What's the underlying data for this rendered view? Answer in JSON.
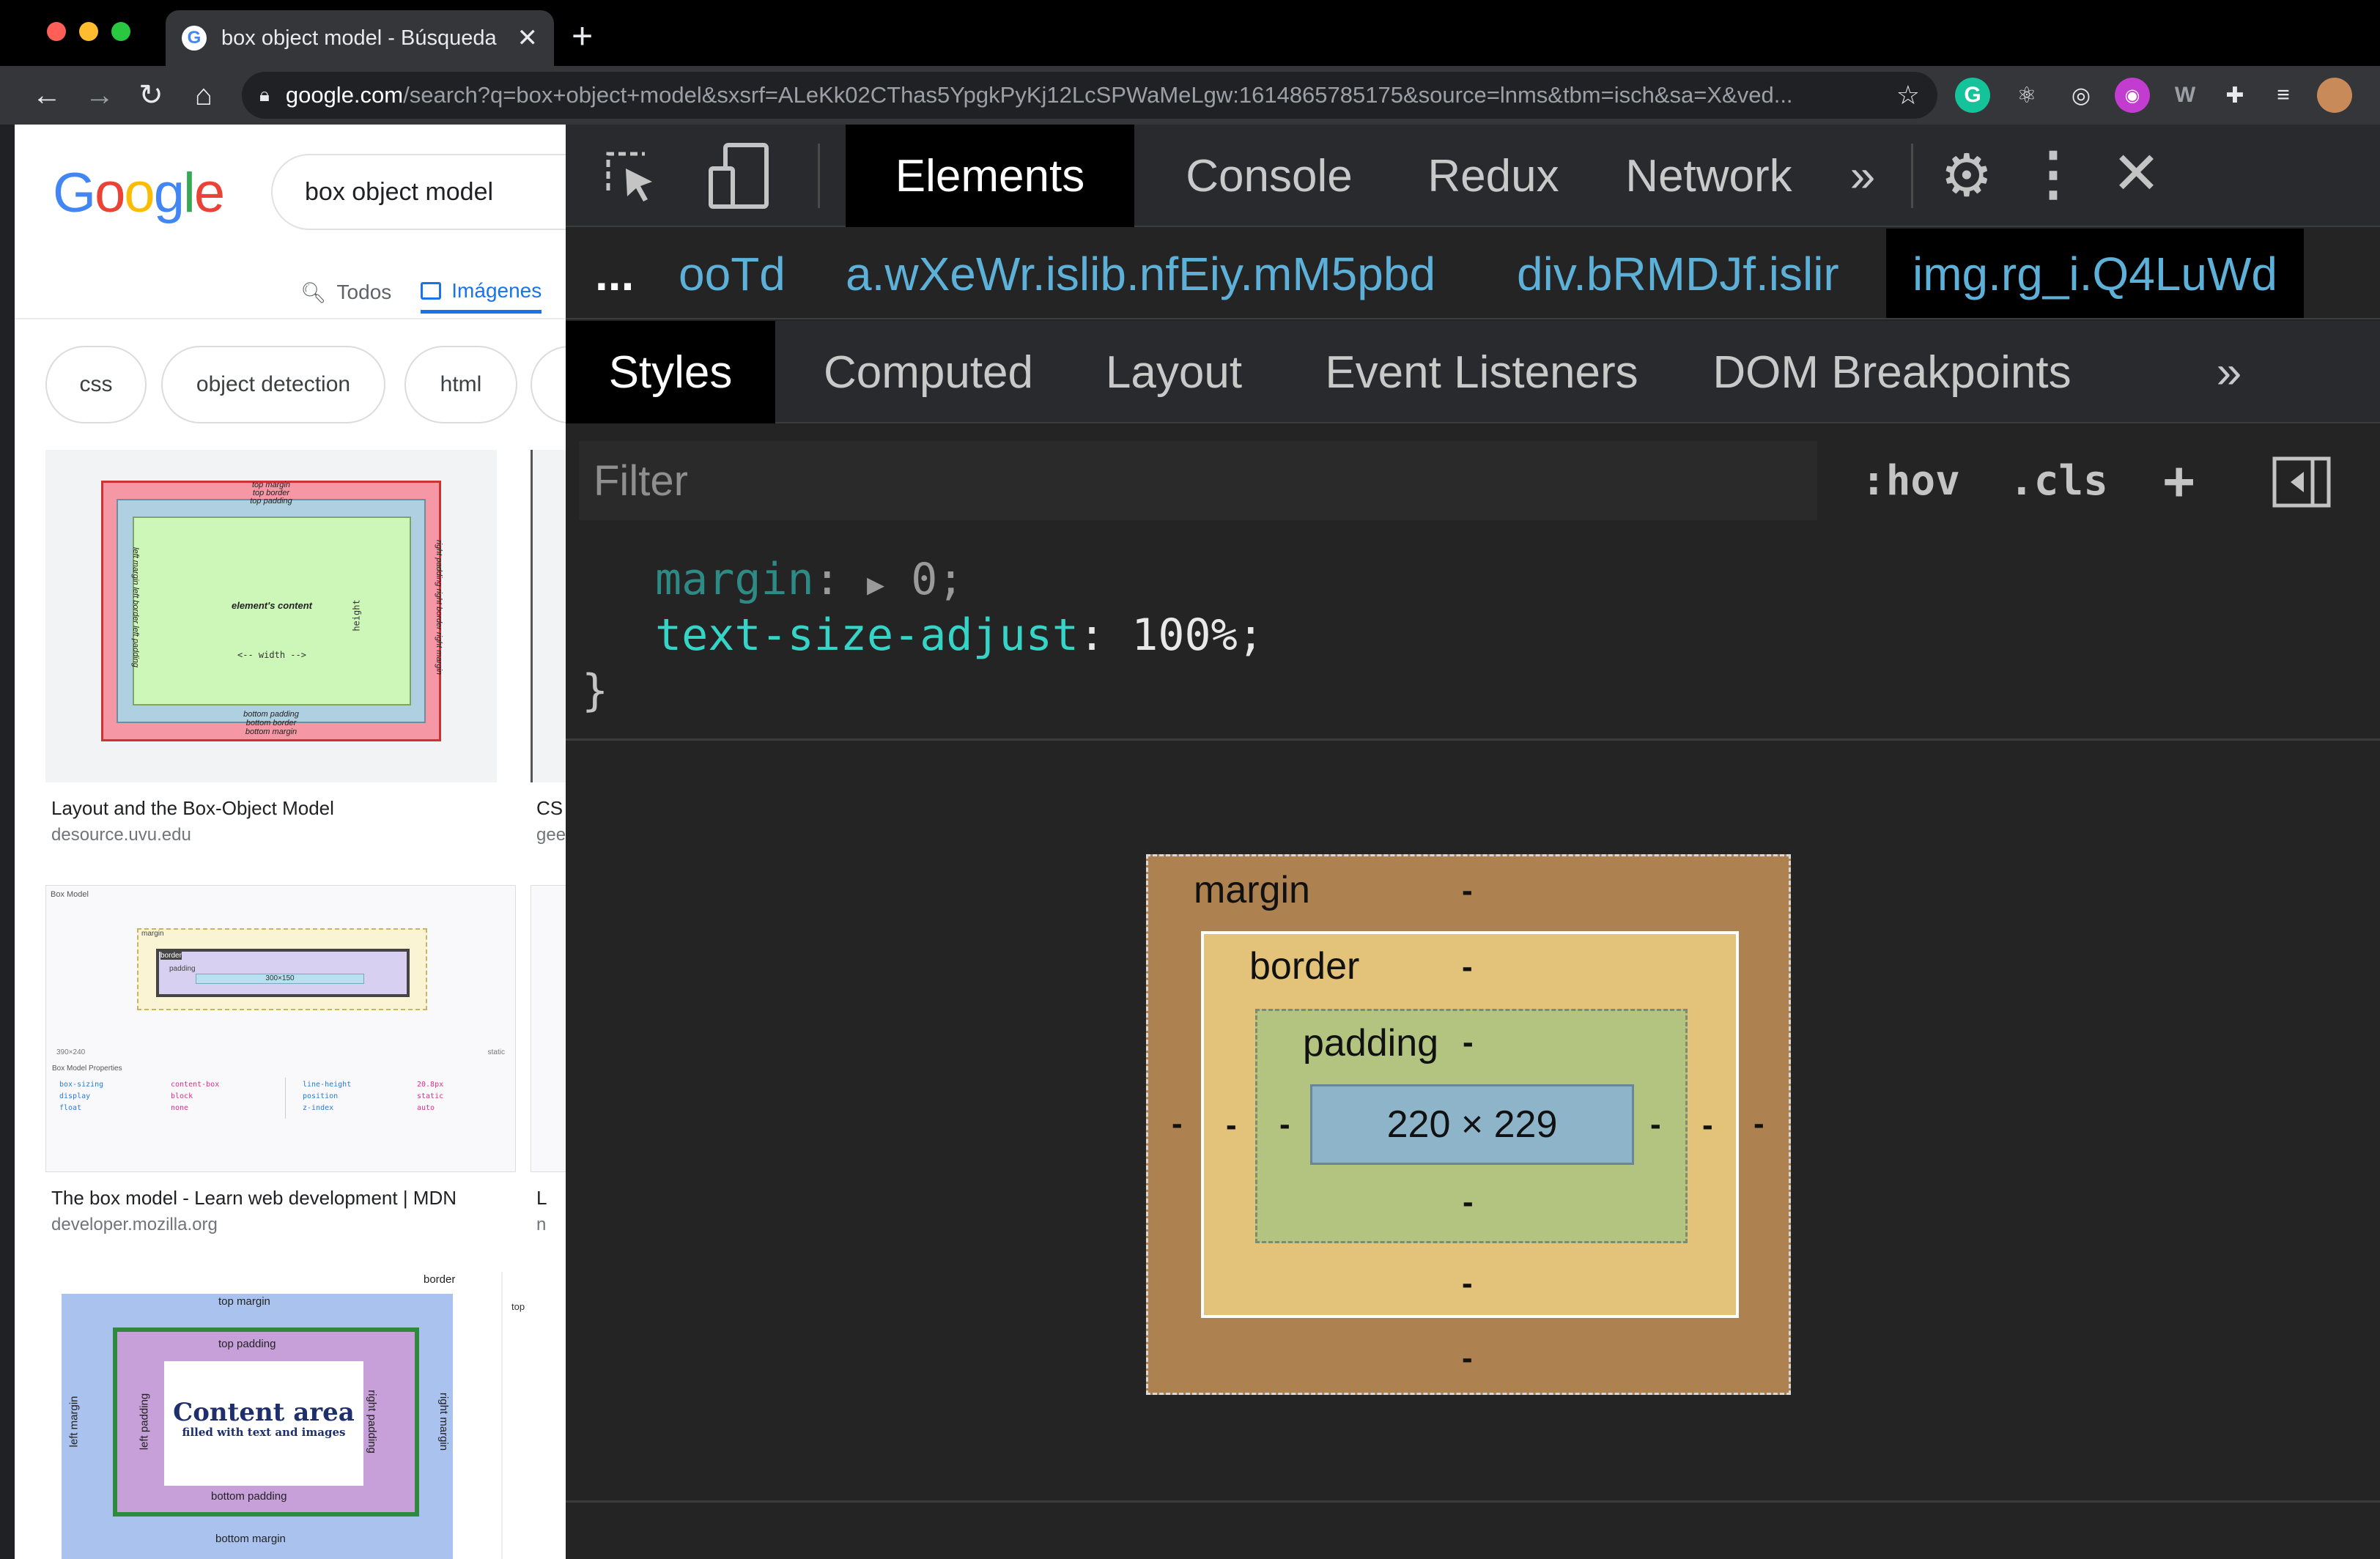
{
  "browser": {
    "tab_title": "box object model - Búsqueda de Google",
    "url_host": "google.com",
    "url_path": "/search?q=box+object+model&sxsrf=ALeKk02CThas5YpgkPyKj12LcSPWaMeLgw:1614865785175&source=lnms&tbm=isch&sa=X&ved...",
    "new_tab_label": "+"
  },
  "google": {
    "logo": "Google",
    "search_value": "box object model",
    "tabs": [
      {
        "label": "Todos",
        "icon": "search-icon"
      },
      {
        "label": "Imágenes",
        "icon": "image-icon"
      }
    ],
    "chips": [
      "css",
      "object detection",
      "html"
    ],
    "results": [
      {
        "title": "Layout and the Box-Object Model",
        "source": "desource.uvu.edu",
        "partial_title": "CS",
        "partial_source": "gee"
      },
      {
        "title": "The box model - Learn web development | MDN",
        "source": "developer.mozilla.org",
        "partial_title": "L",
        "partial_source": "n"
      }
    ],
    "thumb_text": {
      "uvu": {
        "top": [
          "top margin",
          "top border",
          "top padding"
        ],
        "center": "element's content",
        "width": "<-- width -->",
        "height": "height",
        "bottom": [
          "bottom padding",
          "bottom border",
          "bottom margin"
        ],
        "left": [
          "left margin",
          "left border",
          "left padding"
        ],
        "right": [
          "right padding",
          "right border",
          "right margin"
        ]
      },
      "mdn": {
        "header": "Box Model",
        "labels": [
          "margin",
          "border",
          "padding"
        ],
        "size": "300×150",
        "dims": "390×240",
        "status": "static",
        "props_header": "Box Model Properties",
        "props": [
          "box-sizing",
          "display",
          "float",
          "content-box",
          "block",
          "none",
          "line-height",
          "position",
          "z-index",
          "20.8px",
          "static",
          "auto"
        ]
      },
      "third": {
        "title": "Content area",
        "subtitle": "filled with text and images",
        "top_margin": "top margin",
        "top_padding": "top padding",
        "bottom_padding": "bottom padding",
        "bottom_margin": "bottom margin",
        "border": "border",
        "left_margin": "left margin",
        "left_padding": "left padding",
        "right_padding": "right padding",
        "right_margin": "right margin",
        "partial": "top"
      }
    }
  },
  "devtools": {
    "tabs": [
      "Elements",
      "Console",
      "Redux",
      "Network"
    ],
    "more": "»",
    "breadcrumbs": {
      "ellipsis": "...",
      "items": [
        "ooTd",
        "a.wXeWr.islib.nfEiy.mM5pbd",
        "div.bRMDJf.islir",
        "img.rg_i.Q4LuWd"
      ]
    },
    "subtabs": [
      "Styles",
      "Computed",
      "Layout",
      "Event Listeners",
      "DOM Breakpoints"
    ],
    "filter_placeholder": "Filter",
    "filter_buttons": [
      ":hov",
      ".cls",
      "+"
    ],
    "css": [
      {
        "prop": "margin",
        "sep": ":",
        "arrow": "▶",
        "value": "0;"
      },
      {
        "prop": "text-size-adjust",
        "sep": ":",
        "value": "100%;"
      }
    ],
    "closing_brace": "}",
    "box_model": {
      "margin_label": "margin",
      "border_label": "border",
      "padding_label": "padding",
      "content_size": "220 × 229",
      "dash": "-"
    }
  }
}
